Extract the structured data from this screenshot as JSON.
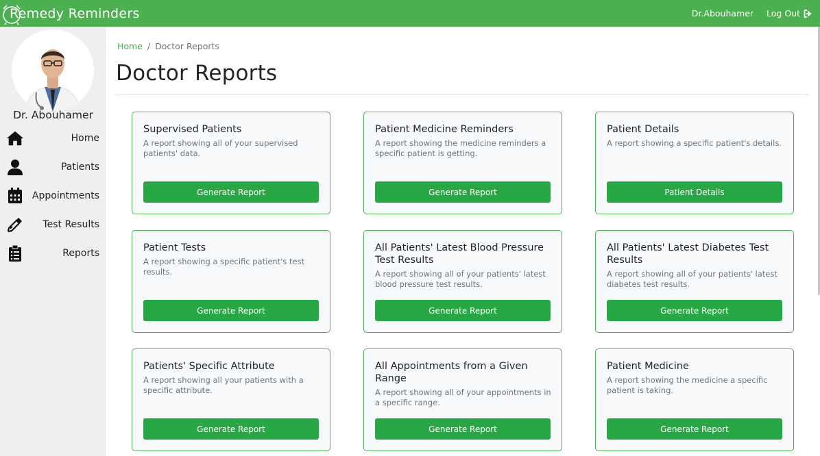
{
  "app": {
    "brand": "Remedy Reminders",
    "user_name": "Dr.Abouhamer",
    "logout_label": "Log Out",
    "accent_color": "#4caf50",
    "button_color": "#28a745"
  },
  "sidebar": {
    "doctor_name": "Dr. Abouhamer",
    "items": [
      {
        "label": "Home",
        "icon": "home-icon"
      },
      {
        "label": "Patients",
        "icon": "user-icon"
      },
      {
        "label": "Appointments",
        "icon": "calendar-icon"
      },
      {
        "label": "Test Results",
        "icon": "eyedropper-icon"
      },
      {
        "label": "Reports",
        "icon": "clipboard-icon"
      }
    ]
  },
  "breadcrumb": {
    "home": "Home",
    "separator": "/",
    "current": "Doctor Reports"
  },
  "page": {
    "title": "Doctor Reports"
  },
  "cards": [
    {
      "title": "Supervised Patients",
      "desc": "A report showing all of your supervised patients' data.",
      "button": "Generate Report"
    },
    {
      "title": "Patient Medicine Reminders",
      "desc": "A report showing the medicine reminders a specific patient is getting.",
      "button": "Generate Report"
    },
    {
      "title": "Patient Details",
      "desc": "A report showing a specific patient's details.",
      "button": "Patient Details"
    },
    {
      "title": "Patient Tests",
      "desc": "A report showing a specific patient's test results.",
      "button": "Generate Report"
    },
    {
      "title": "All Patients' Latest Blood Pressure Test Results",
      "desc": "A report showing all of your patients' latest blood pressure test results.",
      "button": "Generate Report"
    },
    {
      "title": "All Patients' Latest Diabetes Test Results",
      "desc": "A report showing all of your patients' latest diabetes test results.",
      "button": "Generate Report"
    },
    {
      "title": "Patients' Specific Attribute",
      "desc": "A report showing all your patients with a specific attribute.",
      "button": "Generate Report"
    },
    {
      "title": "All Appointments from a Given Range",
      "desc": "A report showing all of your appointments in a specific range.",
      "button": "Generate Report"
    },
    {
      "title": "Patient Medicine",
      "desc": "A report showing the medicine a specific patient is taking.",
      "button": "Generate Report"
    }
  ]
}
